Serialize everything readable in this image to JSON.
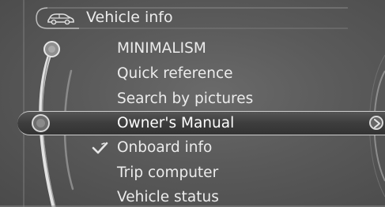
{
  "header": {
    "title": "Vehicle info",
    "icon": "car-icon"
  },
  "menu": {
    "items": [
      {
        "label": "MINIMALISM",
        "selected": false,
        "checked": false
      },
      {
        "label": "Quick reference",
        "selected": false,
        "checked": false
      },
      {
        "label": "Search by pictures",
        "selected": false,
        "checked": false
      },
      {
        "label": "Owner's Manual",
        "selected": true,
        "checked": false
      },
      {
        "label": "Onboard info",
        "selected": false,
        "checked": true,
        "icon": "check-icon"
      },
      {
        "label": "Trip computer",
        "selected": false,
        "checked": false
      },
      {
        "label": "Vehicle status",
        "selected": false,
        "checked": false
      }
    ]
  },
  "controls": {
    "submenu_arrow_icon": "chevron-right-icon",
    "scroll_knob_icon": "controller-knob-icon"
  },
  "colors": {
    "background": "#5a5a5a",
    "text": "#ececec",
    "highlight_border": "#cfcfcf"
  }
}
